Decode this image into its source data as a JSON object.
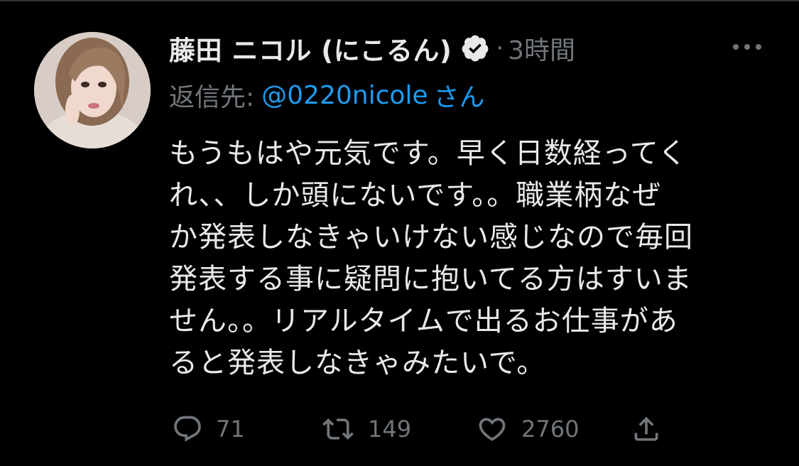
{
  "colors": {
    "background": "#000000",
    "primary_text": "#e7e9ea",
    "secondary_text": "#71767b",
    "link": "#1d9bf0"
  },
  "tweet": {
    "author": {
      "display_name": "藤田 ニコル (にこるん)",
      "verified_icon": "verified-badge-icon",
      "avatar": "avatar"
    },
    "separator": "·",
    "time": "3時間",
    "more_icon": "more-horizontal-icon",
    "reply_to": {
      "prefix": "返信先:",
      "handle": "@0220nicole",
      "suffix": "さん"
    },
    "text_lines": [
      "もうもはや元気です。早く日数経ってく",
      "れ、、しか頭にないです。。職業柄なぜ",
      "か発表しなきゃいけない感じなので毎回",
      "発表する事に疑問に抱いてる方はすいま",
      "せん。。リアルタイムで出るお仕事があ",
      "ると発表しなきゃみたいで。"
    ],
    "actions": {
      "reply": {
        "icon": "reply-icon",
        "count": "71"
      },
      "retweet": {
        "icon": "retweet-icon",
        "count": "149"
      },
      "like": {
        "icon": "heart-icon",
        "count": "2760"
      },
      "share": {
        "icon": "share-icon"
      }
    }
  }
}
